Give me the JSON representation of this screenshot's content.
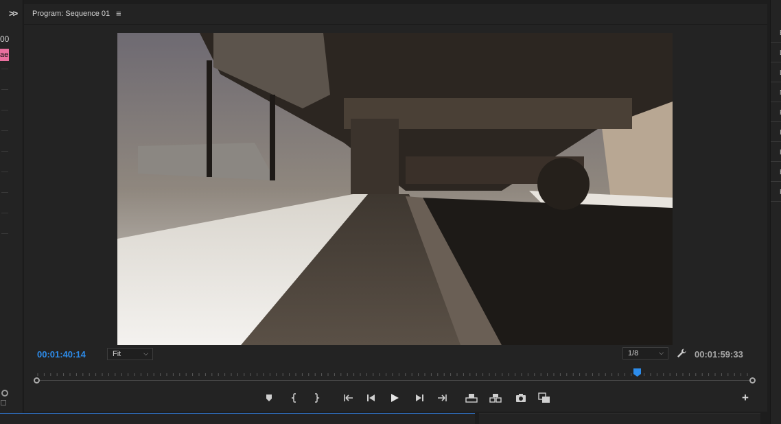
{
  "left_panel": {
    "expand_icon": "double-chevron-right",
    "timecode_fragment": "00",
    "label_fragment": "ae",
    "label_color": "#e9709f"
  },
  "monitor": {
    "title": "Program: Sequence 01",
    "menu_icon": "hamburger-menu",
    "current_time": "00:01:40:14",
    "current_time_color": "#2d8ceb",
    "zoom_value": "Fit",
    "resolution_value": "1/8",
    "settings_icon": "wrench",
    "duration": "00:01:59:33",
    "playhead_position": 0.838,
    "playhead_color": "#2d8ceb"
  },
  "transport": {
    "buttons": [
      {
        "name": "add-marker",
        "icon": "marker"
      },
      {
        "name": "mark-in",
        "icon": "mark-in"
      },
      {
        "name": "mark-out",
        "icon": "mark-out"
      },
      {
        "name": "go-to-in",
        "icon": "go-to-in"
      },
      {
        "name": "step-back",
        "icon": "step-back"
      },
      {
        "name": "play",
        "icon": "play"
      },
      {
        "name": "step-forward",
        "icon": "step-forward"
      },
      {
        "name": "go-to-out",
        "icon": "go-to-out"
      },
      {
        "name": "lift",
        "icon": "lift"
      },
      {
        "name": "extract",
        "icon": "extract"
      },
      {
        "name": "export-frame",
        "icon": "camera"
      },
      {
        "name": "comparison-view",
        "icon": "comparison"
      }
    ],
    "add_button": "+"
  },
  "right_panel": {
    "items": [
      "E",
      "L",
      "L",
      "M",
      "F",
      "I",
      "E",
      "E",
      "F"
    ]
  }
}
